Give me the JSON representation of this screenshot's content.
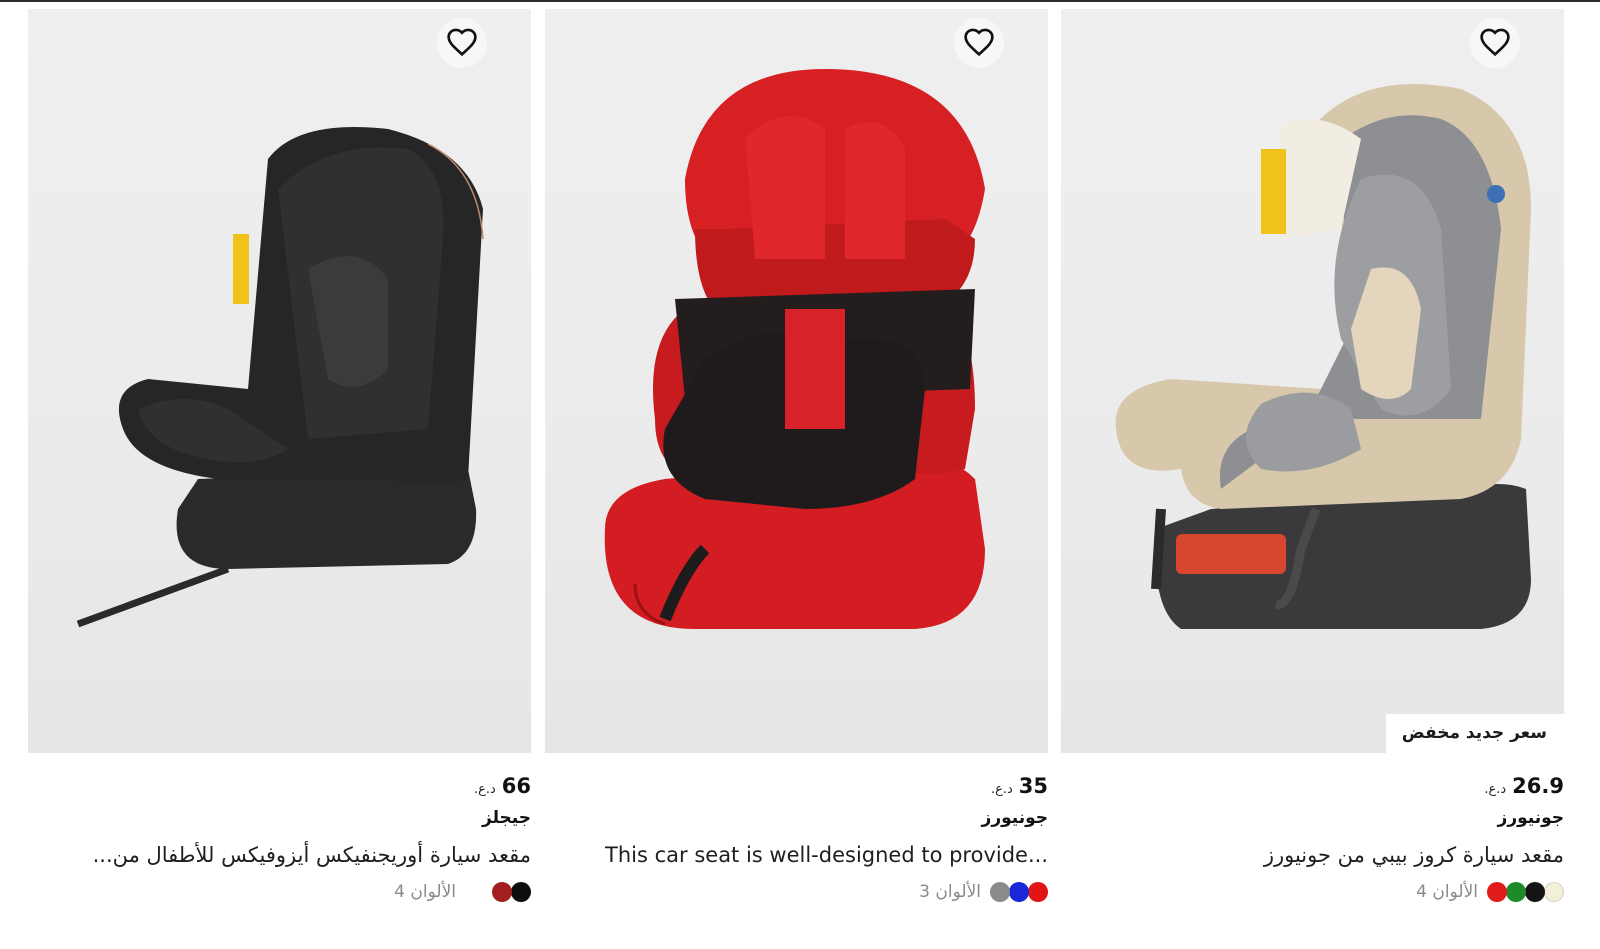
{
  "products": [
    {
      "badge": "سعر جديد مخفض",
      "price": "26.9",
      "currency": "د.ع.",
      "brand": "جونيورز",
      "title": "مقعد سيارة كروز بيبي من جونيورز",
      "colors_label": "الألوان 4",
      "swatches": [
        "#f3f0d9",
        "#141414",
        "#1f8a2a",
        "#e01b1b"
      ]
    },
    {
      "price": "35",
      "currency": "د.ع.",
      "brand": "جونيورز",
      "title": "This car seat is well-designed to provide...",
      "colors_label": "الألوان 3",
      "swatches": [
        "#e31414",
        "#1a27d6",
        "#8a8a8a"
      ]
    },
    {
      "price": "66",
      "currency": "د.ع.",
      "brand": "جيجلز",
      "title": "مقعد سيارة أوريجنفيكس أيزوفيكس للأطفال من...",
      "colors_label": "الألوان 4",
      "swatches": [
        "#0d0d0d",
        "#a31f1f"
      ]
    }
  ],
  "icons": {
    "favorite": "heart-outline-icon"
  }
}
